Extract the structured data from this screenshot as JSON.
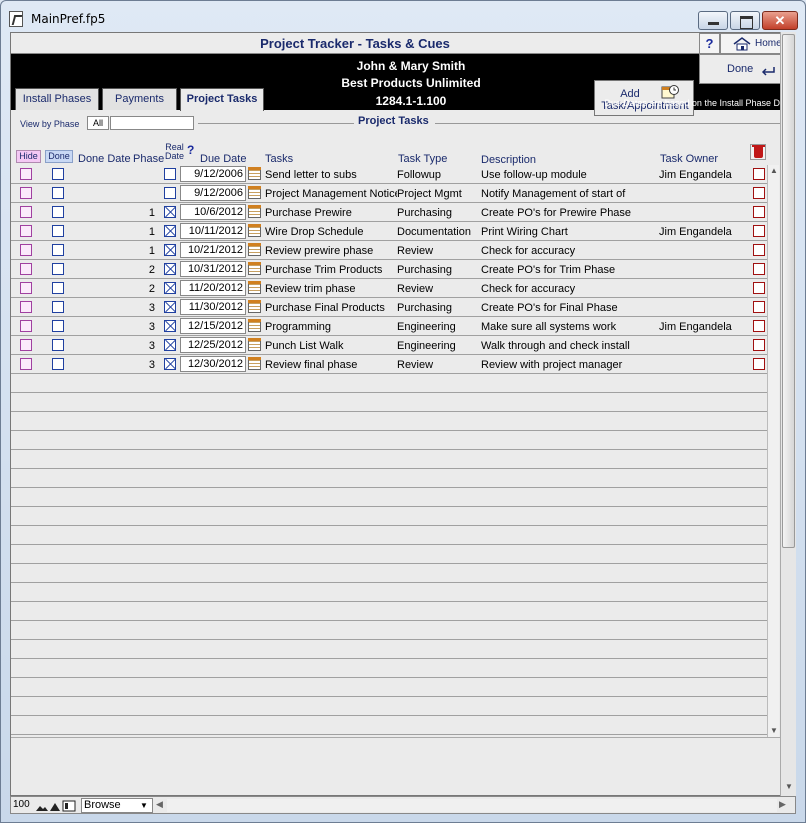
{
  "window": {
    "title": "MainPref.fp5",
    "close_glyph": "✕"
  },
  "header": {
    "title": "Project Tracker - Tasks & Cues",
    "help_glyph": "?",
    "home_label": "Home",
    "done_label": "Done",
    "client_name": "John & Mary Smith",
    "company": "Best Products Unlimited",
    "job_number": "1284.1-1.100",
    "add_task_line1": "Add",
    "add_task_line2": "Task/Appointment",
    "due_note": "Due Dates are based on the Install Phase Dates"
  },
  "tabs": [
    {
      "label": "Install Phases",
      "active": false
    },
    {
      "label": "Payments",
      "active": false
    },
    {
      "label": "Project Tasks",
      "active": true
    }
  ],
  "filter": {
    "view_label": "View by Phase",
    "all_label": "All",
    "phase_value": "",
    "section_title": "Project Tasks"
  },
  "columns": {
    "hide": "Hide",
    "done": "Done",
    "done_date": "Done Date",
    "phase": "Phase",
    "real_date_1": "Real",
    "real_date_2": "Date",
    "real_help": "?",
    "due_date": "Due Date",
    "tasks": "Tasks",
    "task_type": "Task Type",
    "description": "Description",
    "task_owner": "Task Owner"
  },
  "tasks": [
    {
      "phase": "",
      "real_date": false,
      "due_date": "9/12/2006",
      "task": "Send letter to subs",
      "type": "Followup",
      "description": "Use follow-up module",
      "owner": "Jim Engandela"
    },
    {
      "phase": "",
      "real_date": false,
      "due_date": "9/12/2006",
      "task": "Project Management Notice",
      "type": "Project Mgmt",
      "description": "Notify Management of start of",
      "owner": ""
    },
    {
      "phase": "1",
      "real_date": true,
      "due_date": "10/6/2012",
      "task": "Purchase Prewire",
      "type": "Purchasing",
      "description": "Create PO's for Prewire Phase",
      "owner": ""
    },
    {
      "phase": "1",
      "real_date": true,
      "due_date": "10/11/2012",
      "task": "Wire Drop Schedule",
      "type": "Documentation",
      "description": "Print Wiring Chart",
      "owner": "Jim Engandela"
    },
    {
      "phase": "1",
      "real_date": true,
      "due_date": "10/21/2012",
      "task": "Review prewire phase",
      "type": "Review",
      "description": "Check for accuracy",
      "owner": ""
    },
    {
      "phase": "2",
      "real_date": true,
      "due_date": "10/31/2012",
      "task": "Purchase Trim Products",
      "type": "Purchasing",
      "description": "Create PO's for Trim Phase",
      "owner": ""
    },
    {
      "phase": "2",
      "real_date": true,
      "due_date": "11/20/2012",
      "task": "Review trim phase",
      "type": "Review",
      "description": "Check for accuracy",
      "owner": ""
    },
    {
      "phase": "3",
      "real_date": true,
      "due_date": "11/30/2012",
      "task": "Purchase Final Products",
      "type": "Purchasing",
      "description": "Create PO's for Final Phase",
      "owner": ""
    },
    {
      "phase": "3",
      "real_date": true,
      "due_date": "12/15/2012",
      "task": "Programming",
      "type": "Engineering",
      "description": "Make sure all systems work",
      "owner": "Jim Engandela"
    },
    {
      "phase": "3",
      "real_date": true,
      "due_date": "12/25/2012",
      "task": "Punch List Walk",
      "type": "Engineering",
      "description": "Walk through and check install",
      "owner": ""
    },
    {
      "phase": "3",
      "real_date": true,
      "due_date": "12/30/2012",
      "task": "Review  final phase",
      "type": "Review",
      "description": "Review with project manager",
      "owner": ""
    }
  ],
  "statusbar": {
    "zoom": "100",
    "mode": "Browse"
  },
  "colors": {
    "header_text": "#1a2a6c",
    "band": "#000000",
    "hide_accent": "#f4c8f4",
    "done_accent": "#c8d8f4"
  }
}
